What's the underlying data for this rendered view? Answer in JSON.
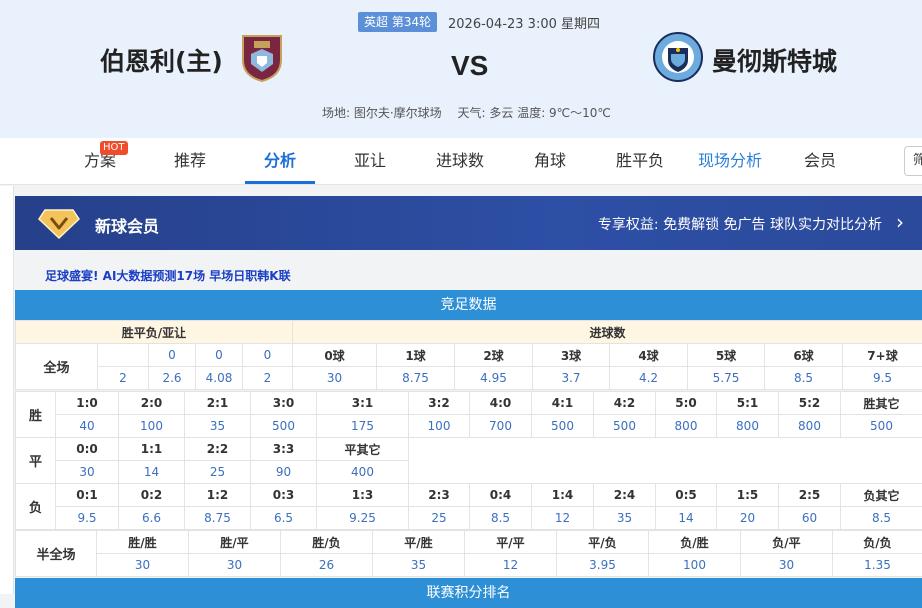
{
  "header": {
    "league_badge": "英超 第34轮",
    "match_time": "2026-04-23 3:00 星期四",
    "home_team": "伯恩利(主)",
    "away_team": "曼彻斯特城",
    "vs": "VS",
    "venue": "场地: 图尔夫·摩尔球场",
    "weather": "天气: 多云 温度: 9℃～10℃"
  },
  "tabs": [
    {
      "label": "方案"
    },
    {
      "label": "推荐"
    },
    {
      "label": "分析"
    },
    {
      "label": "亚让"
    },
    {
      "label": "进球数"
    },
    {
      "label": "角球"
    },
    {
      "label": "胜平负"
    },
    {
      "label": "现场分析"
    },
    {
      "label": "会员"
    }
  ],
  "hot_badge": "HOT",
  "right_input": "筛",
  "vip": {
    "title": "新球会员",
    "perks": "专享权益: 免费解锁 免广告 球队实力对比分析"
  },
  "promo": "足球盛宴! AI大数据预测17场 早场日职韩K联",
  "jz_title": "竞足数据",
  "bottom_title": "联赛积分排名",
  "spf": {
    "title": "胜平负/亚让",
    "row_label": "全场",
    "top": [
      "",
      "0",
      "0",
      "0"
    ],
    "bottom": [
      "2",
      "2.6",
      "4.08",
      "2"
    ]
  },
  "goals": {
    "title": "进球数",
    "headers": [
      "0球",
      "1球",
      "2球",
      "3球",
      "4球",
      "5球",
      "6球",
      "7+球"
    ],
    "values": [
      "30",
      "8.75",
      "4.95",
      "3.7",
      "4.2",
      "5.75",
      "8.5",
      "9.5"
    ]
  },
  "score_win": {
    "label": "胜",
    "headers": [
      "1:0",
      "2:0",
      "2:1",
      "3:0",
      "3:1",
      "3:2",
      "4:0",
      "4:1",
      "4:2",
      "5:0",
      "5:1",
      "5:2",
      "胜其它"
    ],
    "values": [
      "40",
      "100",
      "35",
      "500",
      "175",
      "100",
      "700",
      "500",
      "500",
      "800",
      "800",
      "800",
      "500"
    ]
  },
  "score_draw": {
    "label": "平",
    "headers": [
      "0:0",
      "1:1",
      "2:2",
      "3:3",
      "平其它"
    ],
    "values": [
      "30",
      "14",
      "25",
      "90",
      "400"
    ]
  },
  "score_lose": {
    "label": "负",
    "headers": [
      "0:1",
      "0:2",
      "1:2",
      "0:3",
      "1:3",
      "2:3",
      "0:4",
      "1:4",
      "2:4",
      "0:5",
      "1:5",
      "2:5",
      "负其它"
    ],
    "values": [
      "9.5",
      "6.6",
      "8.75",
      "6.5",
      "9.25",
      "25",
      "8.5",
      "12",
      "35",
      "14",
      "20",
      "60",
      "8.5"
    ]
  },
  "halffull": {
    "label": "半全场",
    "headers": [
      "胜/胜",
      "胜/平",
      "胜/负",
      "平/胜",
      "平/平",
      "平/负",
      "负/胜",
      "负/平",
      "负/负"
    ],
    "values": [
      "30",
      "30",
      "26",
      "35",
      "12",
      "3.95",
      "100",
      "30",
      "1.35"
    ]
  },
  "colors": {
    "accent": "#1a6fd8",
    "table_header": "#2d8fd6",
    "vip_bg": "#26408a",
    "hot": "#f04b2a"
  }
}
